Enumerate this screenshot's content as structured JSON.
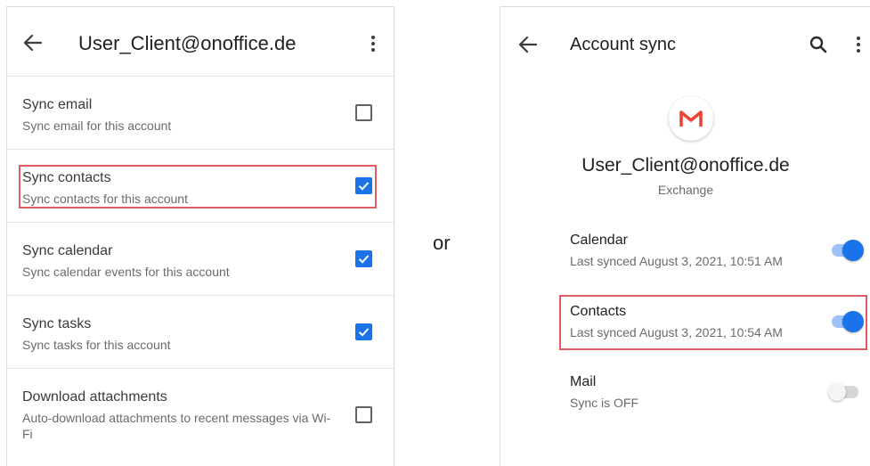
{
  "left": {
    "title": "User_Client@onoffice.de",
    "rows": [
      {
        "title": "Sync email",
        "subtitle": "Sync email for this account",
        "checked": false
      },
      {
        "title": "Sync contacts",
        "subtitle": "Sync contacts for this account",
        "checked": true,
        "highlighted": true
      },
      {
        "title": "Sync calendar",
        "subtitle": "Sync calendar events for this account",
        "checked": true
      },
      {
        "title": "Sync tasks",
        "subtitle": "Sync tasks for this account",
        "checked": true
      },
      {
        "title": "Download attachments",
        "subtitle": "Auto-download attachments to recent messages via Wi-Fi",
        "checked": false
      }
    ]
  },
  "separator": "or",
  "right": {
    "title": "Account sync",
    "account_email": "User_Client@onoffice.de",
    "account_type": "Exchange",
    "items": [
      {
        "title": "Calendar",
        "subtitle": "Last synced August 3, 2021, 10:51 AM",
        "on": true
      },
      {
        "title": "Contacts",
        "subtitle": "Last synced August 3, 2021, 10:54 AM",
        "on": true,
        "highlighted": true
      },
      {
        "title": "Mail",
        "subtitle": "Sync is OFF",
        "on": false
      }
    ]
  },
  "icons": {
    "back": "arrow-left-icon",
    "more": "more-vert-icon",
    "search": "search-icon",
    "logo": "gmail-icon",
    "checkbox": "checkbox-icon"
  },
  "colors": {
    "accent": "#1a73e8",
    "highlight": "#e15b62",
    "gmail_red": "#ea4335"
  }
}
